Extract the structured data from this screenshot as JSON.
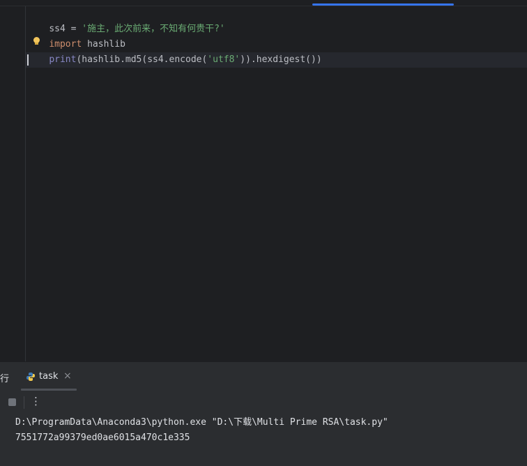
{
  "editor": {
    "lines": [
      {
        "parts": [
          {
            "t": "ss4 = ",
            "c": "plain"
          },
          {
            "t": "'施主，此次前来，不知有何贵干?'",
            "c": "str"
          }
        ]
      },
      {
        "parts": [
          {
            "t": "import",
            "c": "kw"
          },
          {
            "t": " hashlib",
            "c": "plain"
          }
        ]
      },
      {
        "parts": [
          {
            "t": "print",
            "c": "builtin"
          },
          {
            "t": "(hashlib.md5(ss4.encode(",
            "c": "plain"
          },
          {
            "t": "'utf8'",
            "c": "str"
          },
          {
            "t": ")).hexdigest())",
            "c": "plain"
          }
        ]
      }
    ]
  },
  "tool_window": {
    "partial_tab_label": "行",
    "run_tab_label": "task",
    "run_tab_close": "×",
    "more_label": "⋮"
  },
  "console": {
    "lines": [
      "D:\\ProgramData\\Anaconda3\\python.exe \"D:\\下载\\Multi Prime RSA\\task.py\"",
      "7551772a99379ed0ae6015a470c1e335"
    ]
  },
  "colors": {
    "keyword": "#cf8e6d",
    "builtin": "#8888c6",
    "string": "#6aab73",
    "accent": "#3574f0"
  }
}
